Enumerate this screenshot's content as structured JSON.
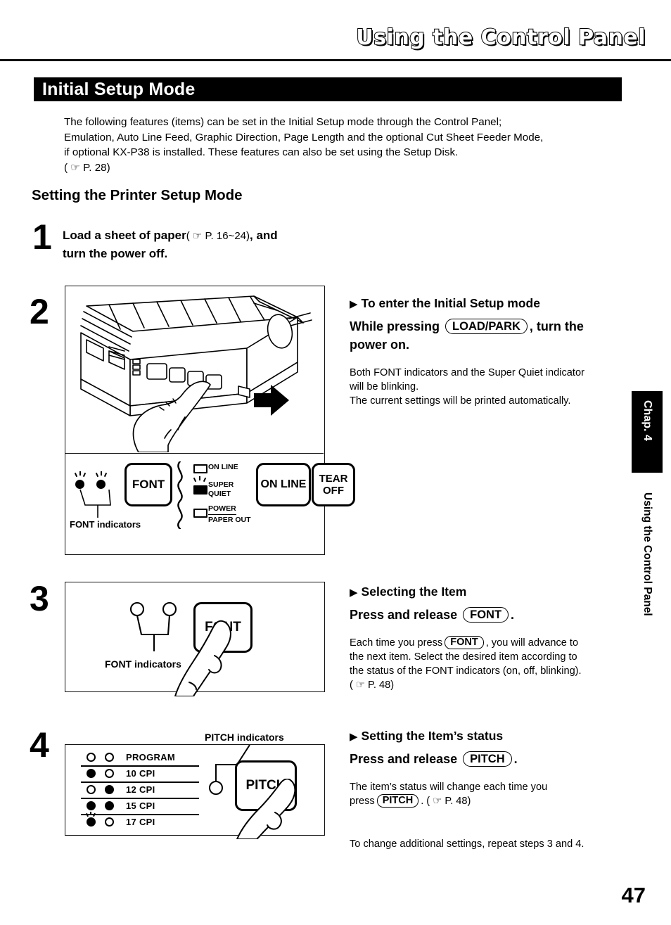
{
  "header": {
    "running_title": "Using the Control Panel",
    "chapter_tab": "Chap. 4",
    "chapter_running": "Using the Control Panel",
    "page_number": "47"
  },
  "section": {
    "title": "Initial Setup Mode",
    "intro_lines": [
      "The following features (items) can be set in the Initial Setup mode through the Control Panel;",
      "Emulation, Auto Line Feed, Graphic Direction, Page Length and the optional Cut Sheet Feeder Mode,",
      "if optional KX-P38 is installed. These features can also be set using the Setup Disk.",
      "( ☞  P. 28)"
    ],
    "subheading": "Setting the Printer Setup Mode"
  },
  "steps": [
    {
      "number": "1",
      "text_bold_1": "Load a sheet of paper",
      "text_ref": "( ☞  P. 16~24)",
      "text_bold_2": ", and",
      "text_line2": "turn the power off."
    },
    {
      "number": "2",
      "arrow_heading": "To enter the Initial Setup mode",
      "lead_before": "While pressing",
      "lead_key": "LOAD/PARK",
      "lead_after": ", turn the",
      "lead_line2": "power on.",
      "body_lines": [
        "Both FONT indicators and the Super Quiet indicator",
        "will be blinking.",
        "The current settings will be printed automatically."
      ]
    },
    {
      "number": "3",
      "arrow_heading": "Selecting the Item",
      "lead_before": "Press and release",
      "lead_key": "FONT",
      "lead_after": ".",
      "body_pre": "Each time you press",
      "body_key": "FONT",
      "body_post": ", you will advance to",
      "body_lines": [
        "the next item. Select the desired item according to",
        "the status of the FONT indicators (on, off, blinking).",
        "( ☞  P. 48)"
      ]
    },
    {
      "number": "4",
      "arrow_heading": "Setting the Item’s status",
      "lead_before": "Press and release",
      "lead_key": "PITCH",
      "lead_after": ".",
      "body_line1": "The item’s status will change each time you",
      "body_pre2": "press",
      "body_key": "PITCH",
      "body_post2": ". ( ☞  P. 48)",
      "extra": "To change additional settings, repeat steps 3 and 4."
    }
  ],
  "figure_panel": {
    "caption_font_indicators": "FONT indicators",
    "buttons": [
      {
        "label": "FONT"
      },
      {
        "label": "ON LINE"
      },
      {
        "label": "TEAR\nOFF",
        "line1": "TEAR",
        "line2": "OFF"
      }
    ],
    "indicators": [
      {
        "label": "ON LINE",
        "state": "off"
      },
      {
        "label_line1": "SUPER",
        "label_line2": "QUIET",
        "state": "blinking"
      },
      {
        "label_line1": "POWER",
        "label_line2": "PAPER OUT",
        "state": "off"
      }
    ]
  },
  "figure_font": {
    "caption": "FONT indicators",
    "button_label": "FONT"
  },
  "figure_pitch": {
    "caption": "PITCH indicators",
    "button_label": "PITCH",
    "rows": [
      {
        "label": "PROGRAM",
        "left": "off",
        "right": "off"
      },
      {
        "label": "10 CPI",
        "left": "on",
        "right": "off"
      },
      {
        "label": "12 CPI",
        "left": "off",
        "right": "on"
      },
      {
        "label": "15 CPI",
        "left": "on",
        "right": "on"
      },
      {
        "label": "17 CPI",
        "left": "blinking",
        "right": "off"
      }
    ]
  },
  "colors": {
    "ink": "#000000",
    "paper": "#ffffff"
  }
}
